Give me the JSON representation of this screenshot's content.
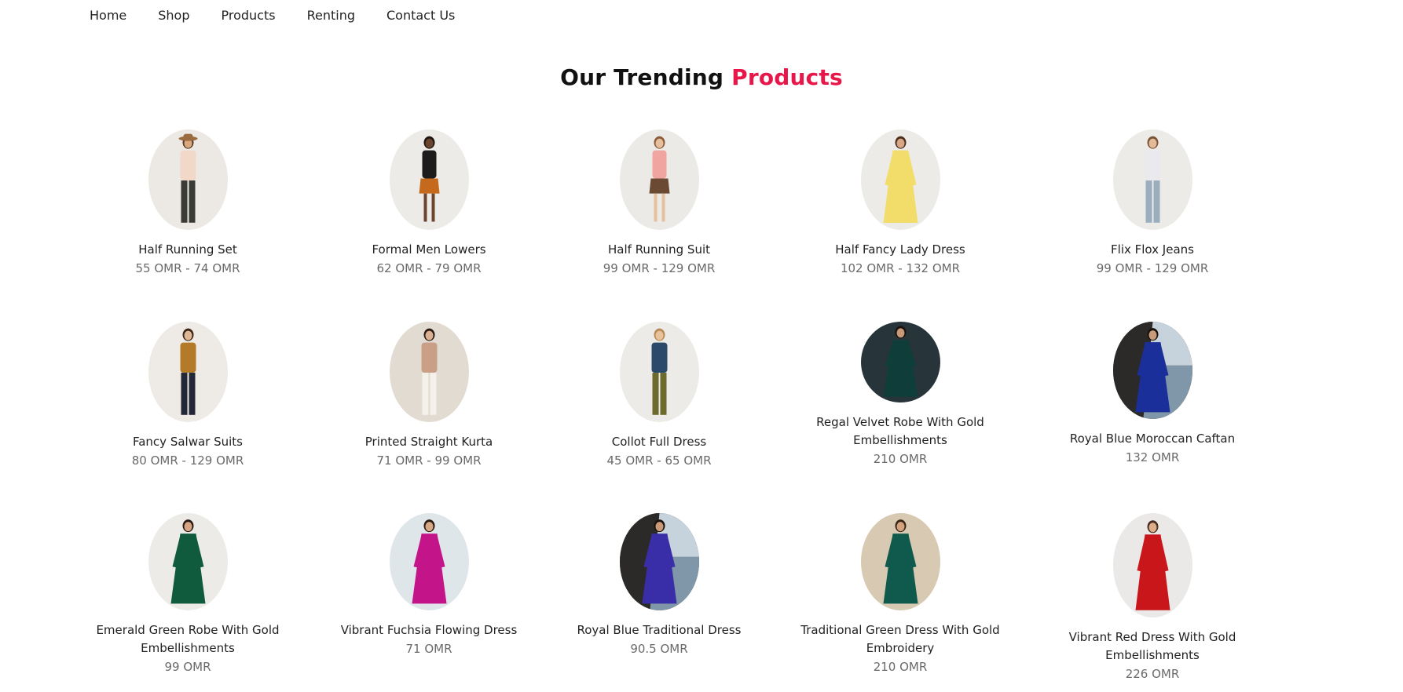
{
  "nav": {
    "items": [
      "Home",
      "Shop",
      "Products",
      "Renting",
      "Contact Us"
    ]
  },
  "section": {
    "title_main": "Our Trending",
    "title_accent": "Products",
    "accent_color": "#e8174a"
  },
  "products": [
    {
      "name": "Half Running Set",
      "price": "55 OMR - 74 OMR",
      "bg": "#ece9e4",
      "top": "#f1d8c8",
      "bottom": "#3a3a36",
      "skin": "#d9a87e",
      "hair": "#5a3a22",
      "accessory": "hat",
      "style": "pants"
    },
    {
      "name": "Formal Men Lowers",
      "price": "62 OMR - 79 OMR",
      "bg": "#ecebe7",
      "top": "#1c1c1c",
      "bottom": "#c56a1c",
      "skin": "#6b4430",
      "hair": "#1e1511",
      "accessory": "none",
      "style": "shorts"
    },
    {
      "name": "Half Running Suit",
      "price": "99 OMR - 129 OMR",
      "bg": "#eceae6",
      "top": "#f1a5a0",
      "bottom": "#6b4a33",
      "skin": "#e6c09c",
      "hair": "#8a5a3a",
      "accessory": "none",
      "style": "skirt"
    },
    {
      "name": "Half Fancy Lady Dress",
      "price": "102 OMR - 132 OMR",
      "bg": "#ecebe8",
      "top": "#f2dd6a",
      "bottom": "#f0d560",
      "skin": "#d8a886",
      "hair": "#4a2d1e",
      "accessory": "none",
      "style": "dress"
    },
    {
      "name": "Flix Flox Jeans",
      "price": "99 OMR - 129 OMR",
      "bg": "#edebe8",
      "top": "#e9e9ee",
      "bottom": "#9aaebe",
      "skin": "#e2bb99",
      "hair": "#7a5236",
      "accessory": "none",
      "style": "pants"
    },
    {
      "name": "Fancy Salwar Suits",
      "price": "80 OMR - 129 OMR",
      "bg": "#eeeae5",
      "top": "#b37a2a",
      "bottom": "#232839",
      "skin": "#e0b794",
      "hair": "#3a2518",
      "accessory": "none",
      "style": "pants"
    },
    {
      "name": "Printed Straight Kurta",
      "price": "71 OMR - 99 OMR",
      "bg": "#e1dbd2",
      "top": "#c9a087",
      "bottom": "#f4f1ea",
      "skin": "#dcb193",
      "hair": "#2a1b12",
      "accessory": "none",
      "style": "pants"
    },
    {
      "name": "Collot Full Dress",
      "price": "45 OMR - 65 OMR",
      "bg": "#ecebe7",
      "top": "#2b4a6b",
      "bottom": "#6c6a2c",
      "skin": "#e7c29c",
      "hair": "#b88a53",
      "accessory": "none",
      "style": "pants"
    },
    {
      "name": "Regal Velvet Robe With Gold Embellishments",
      "price": "210 OMR",
      "bg": "#27353a",
      "top": "#0f3d3a",
      "bottom": "#0f3d3a",
      "skin": "#c79a78",
      "hair": "#1a120c",
      "accessory": "none",
      "style": "robe"
    },
    {
      "name": "Royal Blue Moroccan Caftan",
      "price": "132 OMR",
      "bg": "#3b3a3c",
      "top": "#1b2f9a",
      "bottom": "#1b2f9a",
      "skin": "#c89b7a",
      "hair": "#1a120c",
      "accessory": "sea",
      "style": "robe"
    },
    {
      "name": "Emerald Green Robe With Gold Embellishments",
      "price": "99 OMR",
      "bg": "#ecebe8",
      "top": "#105a3e",
      "bottom": "#105a3e",
      "skin": "#d5a585",
      "hair": "#2b1a10",
      "accessory": "none",
      "style": "robe"
    },
    {
      "name": "Vibrant Fuchsia Flowing Dress",
      "price": "71 OMR",
      "bg": "#dfe6ea",
      "top": "#c4148a",
      "bottom": "#c4148a",
      "skin": "#d7a886",
      "hair": "#2b1a10",
      "accessory": "none",
      "style": "robe"
    },
    {
      "name": "Royal Blue Traditional Dress",
      "price": "90.5 OMR",
      "bg": "#2e2c2a",
      "top": "#3a2ea8",
      "bottom": "#3a2ea8",
      "skin": "#c99a77",
      "hair": "#1a120c",
      "accessory": "sea",
      "style": "robe"
    },
    {
      "name": "Traditional Green Dress With Gold Embroidery",
      "price": "210 OMR",
      "bg": "#d8c9b3",
      "top": "#0f5a4c",
      "bottom": "#0f5a4c",
      "skin": "#d3a27f",
      "hair": "#3a2518",
      "accessory": "none",
      "style": "robe"
    },
    {
      "name": "Vibrant Red Dress With Gold Embellishments",
      "price": "226 OMR",
      "bg": "#ebe9e7",
      "top": "#c8161b",
      "bottom": "#c8161b",
      "skin": "#dcae8c",
      "hair": "#4a2d1e",
      "accessory": "none",
      "style": "robe"
    }
  ]
}
